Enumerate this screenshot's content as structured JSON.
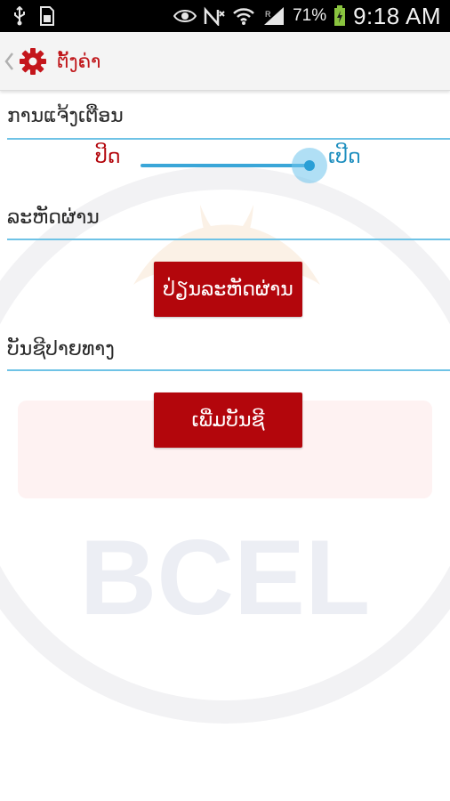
{
  "status_bar": {
    "battery_percent": "71%",
    "time": "9:18 AM",
    "icons": [
      "usb-icon",
      "sd-card-icon",
      "eye-icon",
      "no-signal-icon",
      "wifi-icon",
      "cell-signal-icon",
      "battery-charging-icon"
    ]
  },
  "action_bar": {
    "title": "ຕັ້ງຄ່າ",
    "icons": [
      "back-chevron-icon",
      "gear-icon"
    ]
  },
  "notifications": {
    "label": "ການແຈ້ງເຕືອນ",
    "toggle": {
      "off_label": "ປິດ",
      "on_label": "ເປີດ",
      "state": "on",
      "level": 1.0
    }
  },
  "password": {
    "label": "ລະຫັດຜ່ານ",
    "button_label": "ປ່ຽນລະຫັດຜ່ານ"
  },
  "destination_account": {
    "label": "ບັນຊີປາຍທາງ",
    "button_label": "ເພີ່ມບັນຊີ"
  },
  "watermark": {
    "text": "BCEL",
    "color": "#d81f26"
  },
  "colors": {
    "accent_red": "#b3060c",
    "accent_blue": "#3aa6d8",
    "line_blue": "#6fc3e6"
  }
}
